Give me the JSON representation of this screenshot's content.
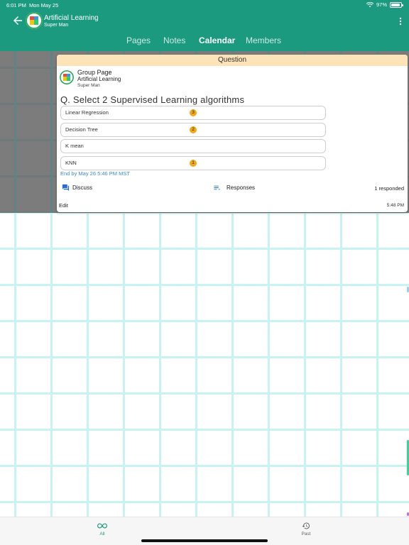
{
  "status": {
    "time": "6:01 PM",
    "date": "Mon May 25",
    "battery": "97%"
  },
  "header": {
    "title": "Artificial Learning",
    "subtitle": "Super Man"
  },
  "tabs": [
    {
      "label": "Pages"
    },
    {
      "label": "Notes"
    },
    {
      "label": "Calendar",
      "active": true
    },
    {
      "label": "Members"
    }
  ],
  "card": {
    "header": "Question",
    "group_label": "Group Page",
    "group_name": "Artificial Learning",
    "group_user": "Super Man",
    "question": "Q. Select 2 Supervised Learning algorithms",
    "options": [
      {
        "label": "Linear Regression",
        "count": "3"
      },
      {
        "label": "Decision Tree",
        "count": "2"
      },
      {
        "label": "K mean",
        "count": ""
      },
      {
        "label": "KNN",
        "count": "1"
      }
    ],
    "deadline": "End by May 26 5:46 PM MST",
    "discuss_label": "Discuss",
    "responses_label": "Responses",
    "responded": "1 responded",
    "edit_label": "Edit",
    "time": "5:48 PM"
  },
  "bottom": {
    "all_label": "All",
    "past_label": "Past"
  },
  "colors": {
    "primary": "#1c9a80",
    "question_header": "#fde3b8",
    "badge": "#f0a91a",
    "link": "#3a8ad6"
  },
  "icons": [
    "back-arrow-icon",
    "more-vert-icon",
    "wifi-icon",
    "battery-icon",
    "chat-icon",
    "list-icon",
    "infinity-icon",
    "history-icon"
  ]
}
